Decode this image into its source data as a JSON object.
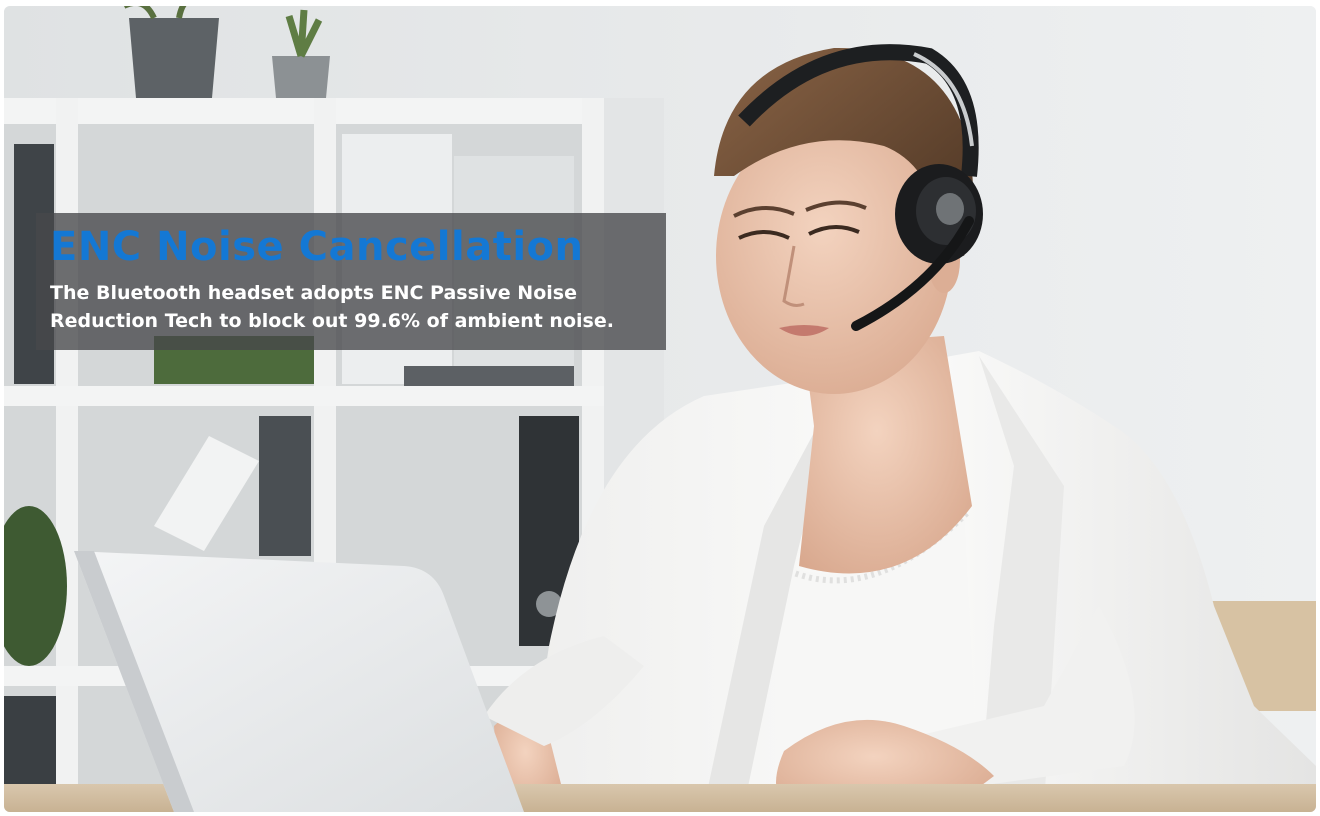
{
  "banner": {
    "headline": "ENC Noise Cancellation",
    "body": "The Bluetooth headset adopts ENC Passive Noise Reduction Tech to block out 99.6% of ambient noise."
  },
  "colors": {
    "headline": "#1478d4",
    "body_text": "#ffffff",
    "banner_bg": "#46484a"
  }
}
